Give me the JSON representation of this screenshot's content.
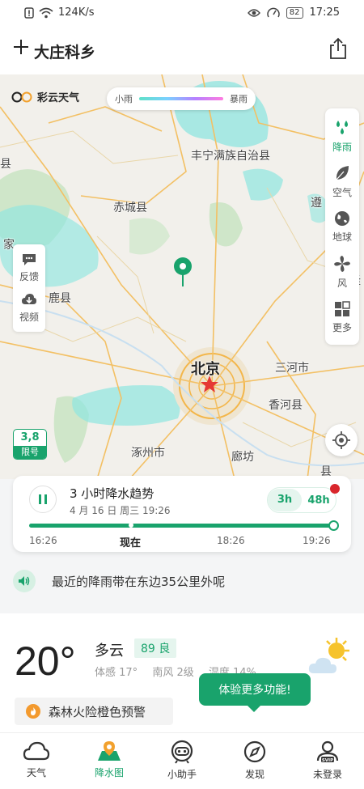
{
  "status": {
    "speed": "124K/s",
    "battery": "82",
    "time": "17:25"
  },
  "header": {
    "title": "大庄科乡"
  },
  "map": {
    "logo": "彩云天气",
    "legend": {
      "low": "小雨",
      "high": "暴雨"
    },
    "right_tools": [
      {
        "label": "降雨",
        "icon": "rain-drops-icon",
        "active": true
      },
      {
        "label": "空气",
        "icon": "leaf-icon",
        "active": false
      },
      {
        "label": "地球",
        "icon": "globe-icon",
        "active": false
      },
      {
        "label": "风",
        "icon": "fan-icon",
        "active": false
      },
      {
        "label": "更多",
        "icon": "grid-icon",
        "active": false
      }
    ],
    "left_tools": [
      {
        "label": "反馈",
        "icon": "feedback-icon"
      },
      {
        "label": "视频",
        "icon": "download-icon"
      }
    ],
    "limit": {
      "numbers": "3,8",
      "label": "限号"
    },
    "labels": {
      "fengning": "丰宁满族自治县",
      "chicheng": "赤城县",
      "beijing": "北京",
      "sanhe": "三河市",
      "xianghe": "香河县",
      "zhuozhou": "涿州市",
      "langfang": "廊坊",
      "lu": "鹿县",
      "jia": "家",
      "xian": "县",
      "zun": "遵",
      "long": "隆",
      "xian2": "县"
    }
  },
  "trend": {
    "title": "3 小时降水趋势",
    "date": "4 月 16 日 周三 19:26",
    "toggle": [
      "3h",
      "48h"
    ],
    "times": [
      "16:26",
      "现在",
      "18:26",
      "19:26"
    ]
  },
  "notice": {
    "text": "最近的降雨带在东边35公里外呢"
  },
  "weather": {
    "temp": "20°",
    "condition": "多云",
    "aqi": "89 良",
    "feels": "体感 17°",
    "wind": "南风 2级",
    "humidity": "湿度 14%",
    "warning": "森林火险橙色预警",
    "tip": "体验更多功能!"
  },
  "nav": [
    {
      "label": "天气",
      "icon": "cloud-icon"
    },
    {
      "label": "降水图",
      "icon": "rain-map-icon"
    },
    {
      "label": "小助手",
      "icon": "assistant-icon"
    },
    {
      "label": "发现",
      "icon": "compass-icon"
    },
    {
      "label": "未登录",
      "icon": "svip-user-icon"
    }
  ]
}
